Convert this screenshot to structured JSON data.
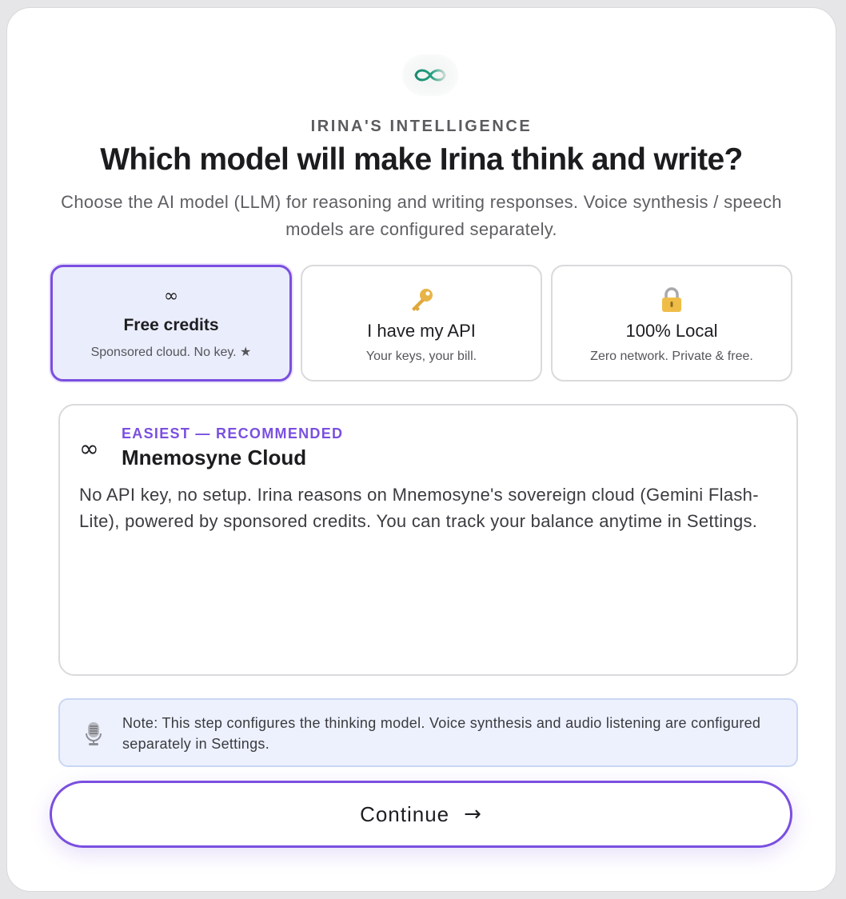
{
  "header": {
    "logo_icon": "infinity-logo-icon",
    "kicker": "IRINA'S INTELLIGENCE",
    "title": "Which model will make Irina think and write?",
    "subtitle": "Choose the AI model (LLM) for reasoning and writing responses. Voice synthesis / speech models are configured separately."
  },
  "options": [
    {
      "icon": "infinity-icon",
      "glyph": "∞",
      "title": "Free credits",
      "subtitle": "Sponsored cloud. No key. ★",
      "selected": true
    },
    {
      "icon": "key-icon",
      "title": "I have my API",
      "subtitle": "Your keys, your bill.",
      "selected": false
    },
    {
      "icon": "lock-icon",
      "title": "100% Local",
      "subtitle": "Zero network. Private & free.",
      "selected": false
    }
  ],
  "detail": {
    "icon": "infinity-icon",
    "glyph": "∞",
    "tag": "EASIEST — RECOMMENDED",
    "title": "Mnemosyne Cloud",
    "body": "No API key, no setup. Irina reasons on Mnemosyne's sovereign cloud (Gemini Flash-Lite), powered by sponsored credits. You can track your balance anytime in Settings."
  },
  "note": {
    "icon": "microphone-icon",
    "text": "Note: This step configures the thinking model. Voice synthesis and audio listening are configured separately in Settings."
  },
  "continue_button": {
    "label": "Continue",
    "arrow": "→"
  },
  "colors": {
    "accent": "#7a4fe0",
    "selected_bg": "#eaedfb",
    "note_bg": "#edf1fd",
    "logo_teal": "#1f8f74",
    "key_gold": "#e8b447"
  }
}
